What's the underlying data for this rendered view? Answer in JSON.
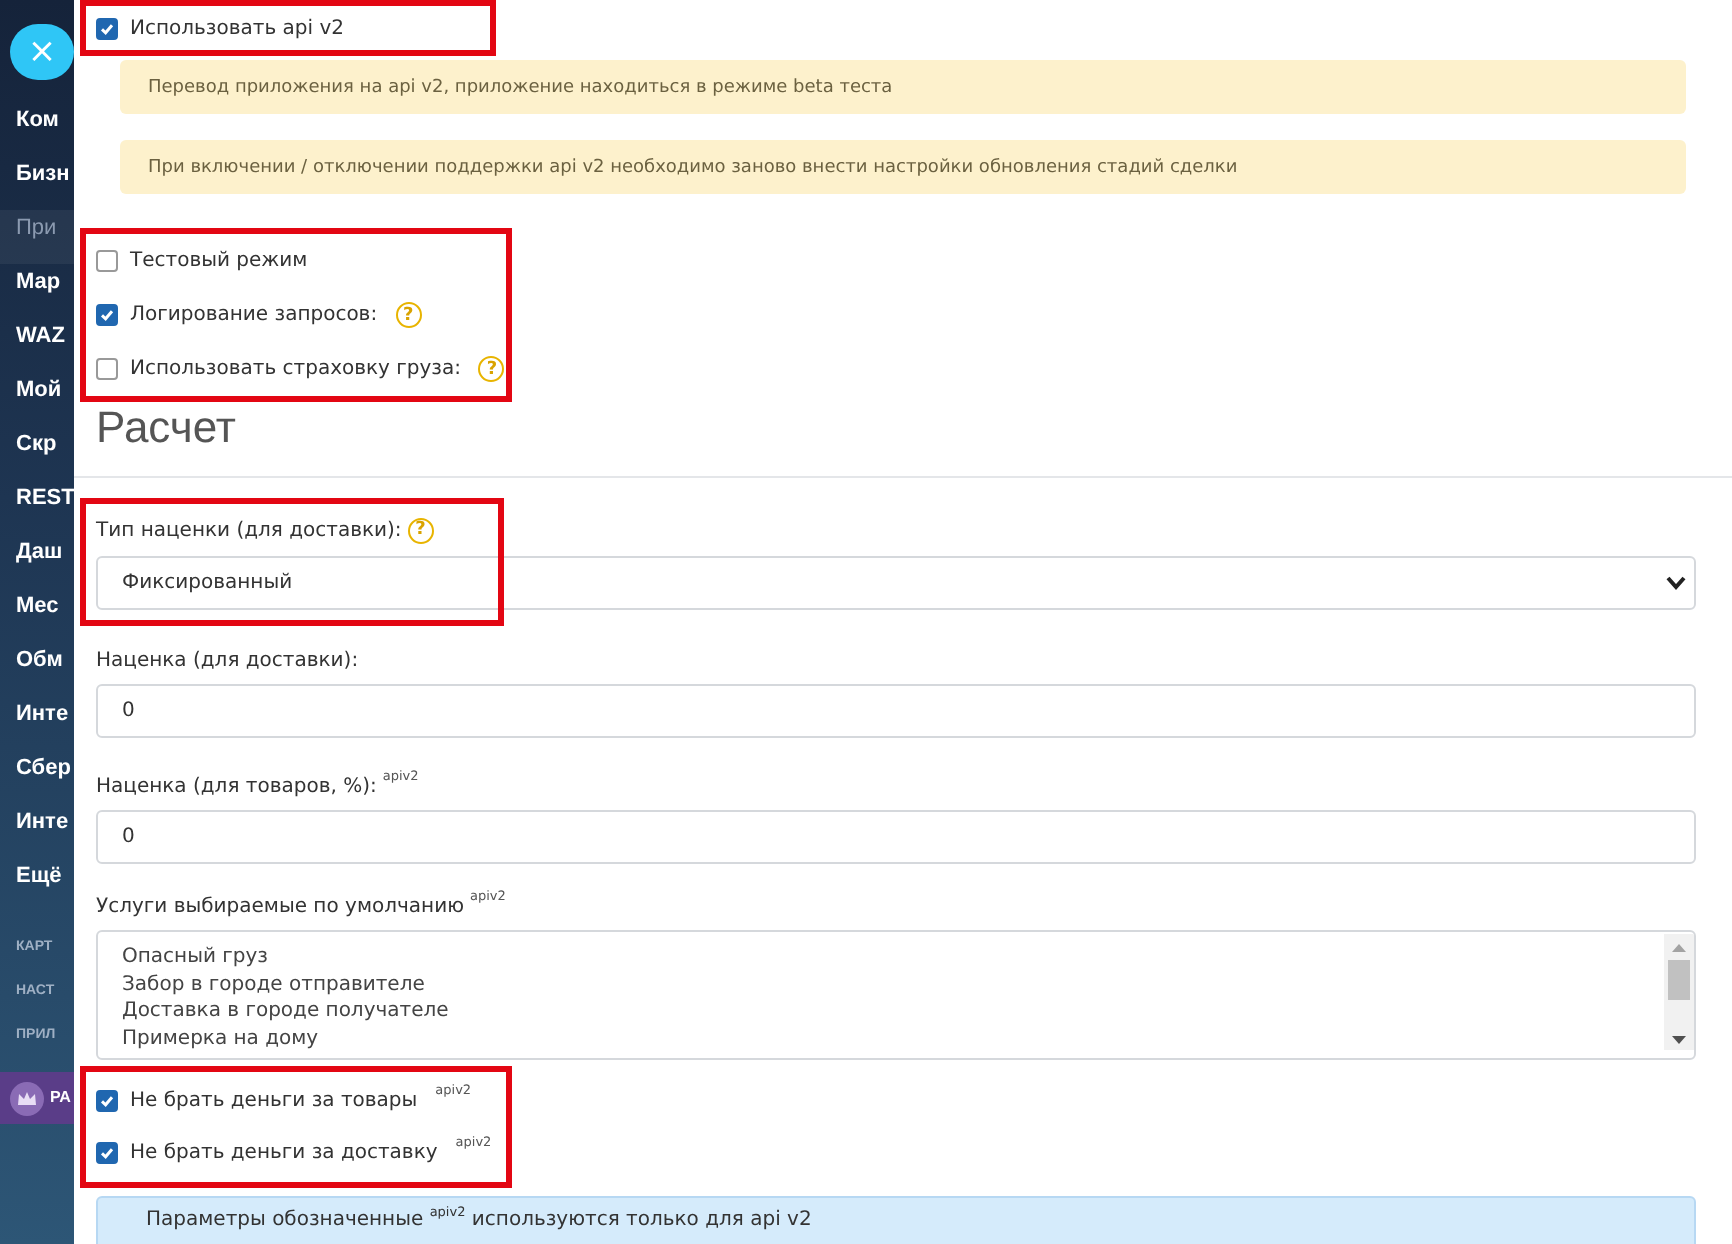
{
  "close_button": {
    "label": "×"
  },
  "sidebar": {
    "items": [
      {
        "label": "Ком",
        "kind": "item"
      },
      {
        "label": "Бизн",
        "kind": "item"
      },
      {
        "label": "При",
        "kind": "muted"
      },
      {
        "label": "Мар",
        "kind": "item"
      },
      {
        "label": "WAZ",
        "kind": "item"
      },
      {
        "label": "Мой",
        "kind": "item"
      },
      {
        "label": "Скр",
        "kind": "item"
      },
      {
        "label": "REST",
        "kind": "item"
      },
      {
        "label": "Даш",
        "kind": "item"
      },
      {
        "label": "Мес",
        "kind": "item"
      },
      {
        "label": "Обм",
        "kind": "item"
      },
      {
        "label": "Инте",
        "kind": "item"
      },
      {
        "label": "Сбер",
        "kind": "item"
      },
      {
        "label": "Инте",
        "kind": "item"
      },
      {
        "label": "Ещё",
        "kind": "item"
      },
      {
        "label": "КАРТ",
        "kind": "section"
      },
      {
        "label": "НАСТ",
        "kind": "section"
      },
      {
        "label": "ПРИЛ",
        "kind": "section"
      },
      {
        "label": "РА",
        "kind": "app"
      }
    ]
  },
  "form": {
    "api_v2": {
      "label": "Использовать api v2",
      "checked": true,
      "highlighted": true
    },
    "alerts": [
      "Перевод приложения на api v2, приложение находиться в режиме beta теста",
      "При включении / отключении поддержки api v2 необходимо заново внести настройки обновления стадий сделки"
    ],
    "options": {
      "highlighted": true,
      "items": [
        {
          "label": "Тестовый режим",
          "checked": false
        },
        {
          "label": "Логирование запросов:",
          "checked": true,
          "help": "?"
        },
        {
          "label": "Использовать страховку груза:",
          "checked": false,
          "help": "?"
        }
      ]
    },
    "section_title": "Расчет",
    "markup_type": {
      "label": "Тип наценки (для доставки):",
      "help": "?",
      "value": "Фиксированный",
      "highlighted": true
    },
    "fields": [
      {
        "label": "Наценка (для доставки):",
        "value": "0"
      },
      {
        "label": "Наценка (для товаров, %):",
        "badge": "apiv2",
        "value": "0"
      }
    ],
    "services": {
      "label": "Услуги выбираемые по умолчанию",
      "badge": "apiv2",
      "options": [
        "Опасный груз",
        "Забор в городе отправителе",
        "Доставка в городе получателе",
        "Примерка на дому"
      ]
    },
    "money_options": {
      "highlighted": true,
      "items": [
        {
          "label": "Не брать деньги за товары",
          "badge": "apiv2",
          "checked": true
        },
        {
          "label": "Не брать деньги за доставку",
          "badge": "apiv2",
          "checked": true
        }
      ]
    },
    "info": "Параметры обозначенные $^{apiv2}$ используются только для api v2"
  }
}
